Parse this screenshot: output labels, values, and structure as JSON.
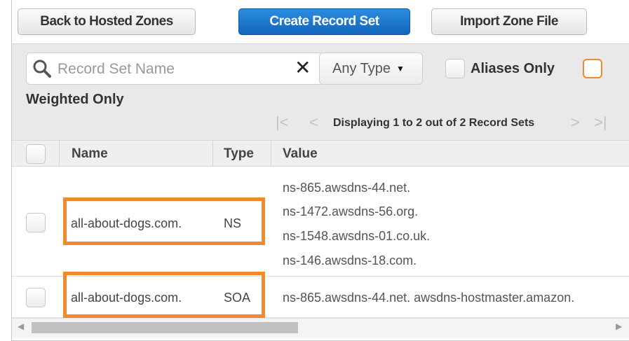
{
  "toolbar": {
    "back_label": "Back to Hosted Zones",
    "create_label": "Create Record Set",
    "import_label": "Import Zone File"
  },
  "filters": {
    "search_placeholder": "Record Set Name",
    "clear_symbol": "✕",
    "type_selected": "Any Type",
    "aliases_label": "Aliases Only",
    "weighted_label": "Weighted Only"
  },
  "pagination": {
    "text": "Displaying 1 to 2 out of 2 Record Sets"
  },
  "table": {
    "columns": [
      "Name",
      "Type",
      "Value"
    ],
    "rows": [
      {
        "name": "all-about-dogs.com.",
        "type": "NS",
        "values": [
          "ns-865.awsdns-44.net.",
          "ns-1472.awsdns-56.org.",
          "ns-1548.awsdns-01.co.uk.",
          "ns-146.awsdns-18.com."
        ]
      },
      {
        "name": "all-about-dogs.com.",
        "type": "SOA",
        "values": [
          "ns-865.awsdns-44.net. awsdns-hostmaster.amazon."
        ]
      }
    ]
  },
  "colors": {
    "accent": "#f08a2c",
    "primary_button": "#1a75c9"
  }
}
